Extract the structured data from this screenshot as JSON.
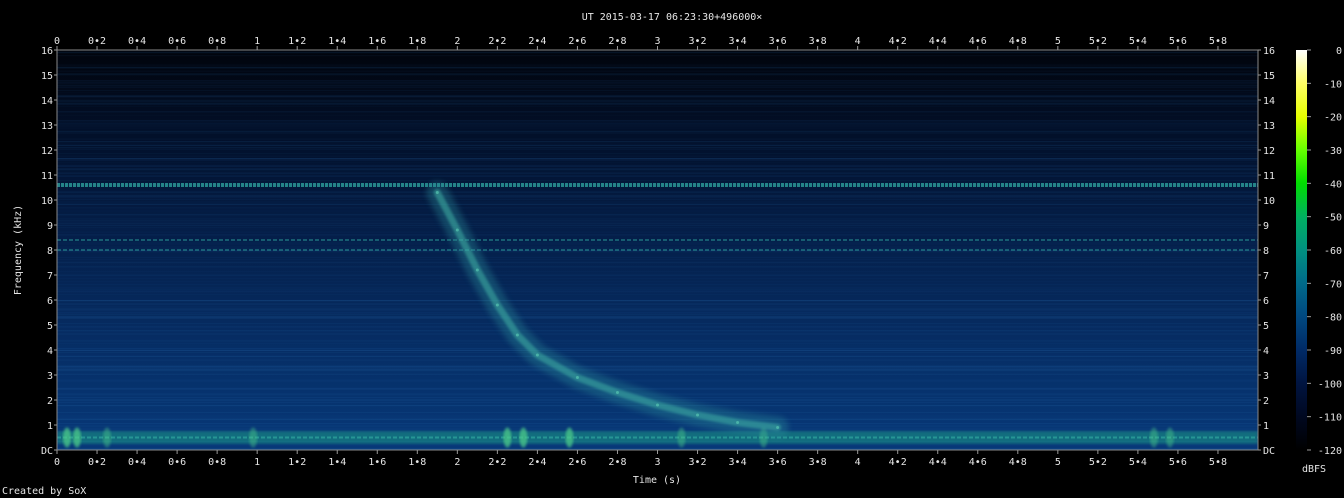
{
  "title": "UT 2015-03-17 06:23:30+496000×",
  "credit": "Created by SoX",
  "colorbar": {
    "unit": "dBFS",
    "ticks": [
      "0",
      "-10",
      "-20",
      "-30",
      "-40",
      "-50",
      "-60",
      "-70",
      "-80",
      "-90",
      "-100",
      "-110",
      "-120"
    ],
    "stops": [
      "#ffffff",
      "#ffff66",
      "#e6ff00",
      "#66ff00",
      "#00dd00",
      "#00b060",
      "#009080",
      "#006a8a",
      "#004880",
      "#002a66",
      "#001440",
      "#000820",
      "#000000"
    ]
  },
  "chart_data": {
    "type": "heatmap",
    "title": "UT 2015-03-17 06:23:30+496000×",
    "xlabel": "Time (s)",
    "ylabel": "Frequency (kHz)",
    "xlim": [
      0,
      6.0
    ],
    "ylim": [
      0,
      16
    ],
    "x_ticks": [
      0,
      0.2,
      0.4,
      0.6,
      0.8,
      1,
      1.2,
      1.4,
      1.6,
      1.8,
      2,
      2.2,
      2.4,
      2.6,
      2.8,
      3,
      3.2,
      3.4,
      3.6,
      3.8,
      4,
      4.2,
      4.4,
      4.6,
      4.8,
      5,
      5.2,
      5.4,
      5.6,
      5.8
    ],
    "x_tick_labels": [
      "0",
      "0•2",
      "0•4",
      "0•6",
      "0•8",
      "1",
      "1•2",
      "1•4",
      "1•6",
      "1•8",
      "2",
      "2•2",
      "2•4",
      "2•6",
      "2•8",
      "3",
      "3•2",
      "3•4",
      "3•6",
      "3•8",
      "4",
      "4•2",
      "4•4",
      "4•6",
      "4•8",
      "5",
      "5•2",
      "5•4",
      "5•6",
      "5•8"
    ],
    "y_ticks": [
      0,
      1,
      2,
      3,
      4,
      5,
      6,
      7,
      8,
      9,
      10,
      11,
      12,
      13,
      14,
      15,
      16
    ],
    "y_tick_labels": [
      "DC",
      "1",
      "2",
      "3",
      "4",
      "5",
      "6",
      "7",
      "8",
      "9",
      "10",
      "11",
      "12",
      "13",
      "14",
      "15",
      "16"
    ],
    "z_unit": "dBFS",
    "z_range": [
      -120,
      0
    ],
    "features": {
      "horizontal_lines_khz": [
        10.6,
        8.4,
        8.0,
        0.5
      ],
      "vertical_impulses_s": [
        0.05,
        0.1,
        0.25,
        0.98,
        2.25,
        2.33,
        2.56,
        3.12,
        3.53,
        5.48,
        5.56
      ],
      "tonal_sweep": {
        "times_s": [
          1.9,
          2.0,
          2.1,
          2.2,
          2.3,
          2.4,
          2.6,
          2.8,
          3.0,
          3.2,
          3.4,
          3.6
        ],
        "freqs_khz": [
          10.3,
          8.8,
          7.2,
          5.8,
          4.6,
          3.8,
          2.9,
          2.3,
          1.8,
          1.4,
          1.1,
          0.9
        ]
      }
    }
  }
}
